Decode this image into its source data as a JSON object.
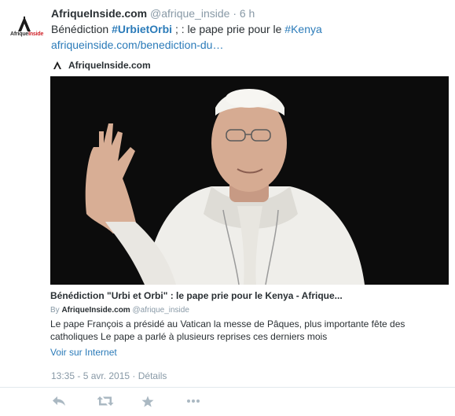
{
  "tweet": {
    "display_name": "AfriqueInside.com",
    "handle": "@afrique_inside",
    "separator": "·",
    "age": "6 h",
    "text_prefix": "Bénédiction ",
    "hashtag1": "#UrbietOrbi",
    "text_middle": " ; : le pape prie pour le ",
    "hashtag2": "#Kenya",
    "link": "afriqueinside.com/benediction-du…"
  },
  "avatar": {
    "brand_black": "Afrique",
    "brand_red": "Inside",
    "accent": "#d0232a"
  },
  "attribution": {
    "site_name": "AfriqueInside.com"
  },
  "card": {
    "title": "Bénédiction \"Urbi et Orbi\" : le pape prie pour le Kenya - Afrique...",
    "by_label": "By ",
    "by_name": "AfriqueInside.com",
    "by_handle": " @afrique_inside",
    "description": "Le pape François a présidé au Vatican la messe de Pâques, plus importante fête des catholiques Le pape a parlé à plusieurs reprises ces derniers mois",
    "read_more": "Voir sur Internet"
  },
  "meta": {
    "timestamp": "13:35 - 5 avr. 2015",
    "separator": " · ",
    "details": "Détails"
  },
  "actions": {
    "icons": [
      "reply-icon",
      "retweet-icon",
      "favorite-icon",
      "more-icon"
    ],
    "icon_color": "#aab8c2"
  },
  "colors": {
    "link": "#2b7bb9",
    "muted": "#8899a6",
    "text": "#292f33"
  }
}
